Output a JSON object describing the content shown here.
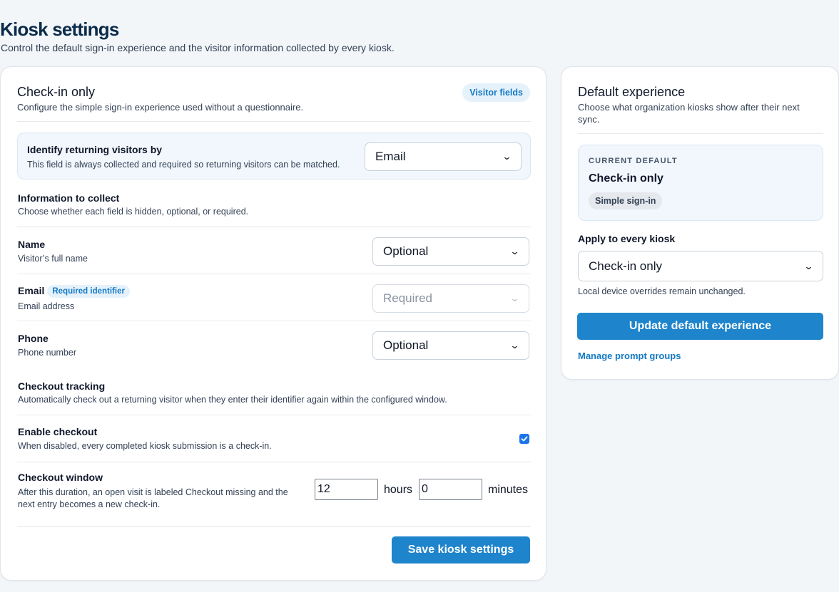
{
  "page": {
    "title": "Kiosk settings",
    "subtitle": "Control the default sign-in experience and the visitor information collected by every kiosk."
  },
  "checkin": {
    "title": "Check-in only",
    "description": "Configure the simple sign-in experience used without a questionnaire.",
    "visitor_fields_link": "Visitor fields",
    "identify": {
      "label": "Identify returning visitors by",
      "help": "This field is always collected and required so returning visitors can be matched.",
      "value": "Email"
    },
    "collect": {
      "heading": "Information to collect",
      "description": "Choose whether each field is hidden, optional, or required."
    },
    "fields": [
      {
        "label": "Name",
        "description": "Visitor’s full name",
        "value": "Optional",
        "badge": ""
      },
      {
        "label": "Email",
        "description": "Email address",
        "value": "Required",
        "badge": "Required identifier"
      },
      {
        "label": "Phone",
        "description": "Phone number",
        "value": "Optional",
        "badge": ""
      }
    ],
    "checkout": {
      "heading": "Checkout tracking",
      "description": "Automatically check out a returning visitor when they enter their identifier again within the configured window.",
      "enable_label": "Enable checkout",
      "enable_help": "When disabled, every completed kiosk submission is a check-in.",
      "enabled": true,
      "window_label": "Checkout window",
      "window_help": "After this duration, an open visit is labeled Checkout missing and the next entry becomes a new check-in.",
      "hours": "12",
      "hours_unit": "hours",
      "minutes": "0",
      "minutes_unit": "minutes"
    },
    "save_label": "Save kiosk settings"
  },
  "default_experience": {
    "title": "Default experience",
    "description": "Choose what organization kiosks show after their next sync.",
    "current_eyebrow": "CURRENT DEFAULT",
    "current_name": "Check-in only",
    "current_tag": "Simple sign-in",
    "apply_label": "Apply to every kiosk",
    "apply_value": "Check-in only",
    "apply_help": "Local device overrides remain unchanged.",
    "update_label": "Update default experience",
    "manage_link": "Manage prompt groups"
  },
  "colors": {
    "accent": "#1e84cc",
    "link": "#1479c4",
    "panel_tint": "#f1f7fc",
    "background": "#f3f6f9"
  },
  "icons": {
    "select_chevron": "chevron-down-icon",
    "checkbox_check": "check-icon"
  }
}
